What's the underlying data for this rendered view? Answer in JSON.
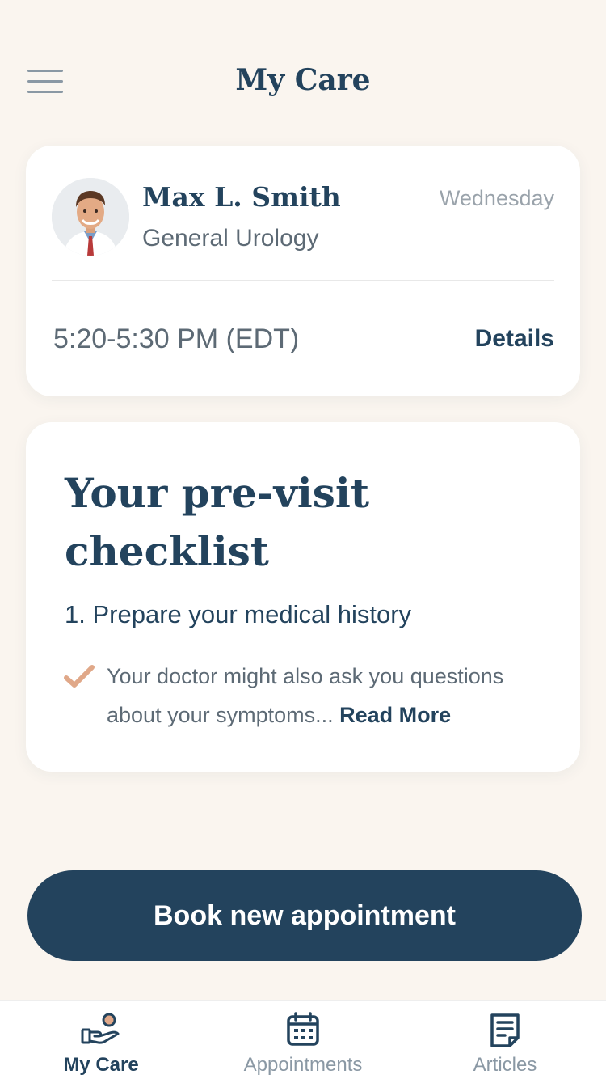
{
  "header": {
    "title": "My Care",
    "menu_icon": "hamburger-menu-icon"
  },
  "appointment": {
    "doctor_name": "Max L. Smith",
    "specialty": "General Urology",
    "day": "Wednesday",
    "time": "5:20-5:30 PM (EDT)",
    "details_label": "Details"
  },
  "checklist": {
    "title": "Your pre-visit checklist",
    "step": "1. Prepare your medical history",
    "note": "Your doctor might also ask you questions about your symptoms...",
    "read_more_label": "Read More",
    "check_icon": "checkmark-icon"
  },
  "actions": {
    "book_label": "Book new appointment"
  },
  "bottom_nav": {
    "items": [
      {
        "label": "My Care",
        "icon": "hand-care-icon",
        "active": true
      },
      {
        "label": "Appointments",
        "icon": "calendar-icon",
        "active": false
      },
      {
        "label": "Articles",
        "icon": "article-icon",
        "active": false
      }
    ]
  },
  "colors": {
    "background": "#faf5ef",
    "primary": "#23435d",
    "muted_text": "#5d6a75",
    "inactive": "#8a98a4",
    "accent_check": "#e0a889",
    "card": "#ffffff"
  }
}
